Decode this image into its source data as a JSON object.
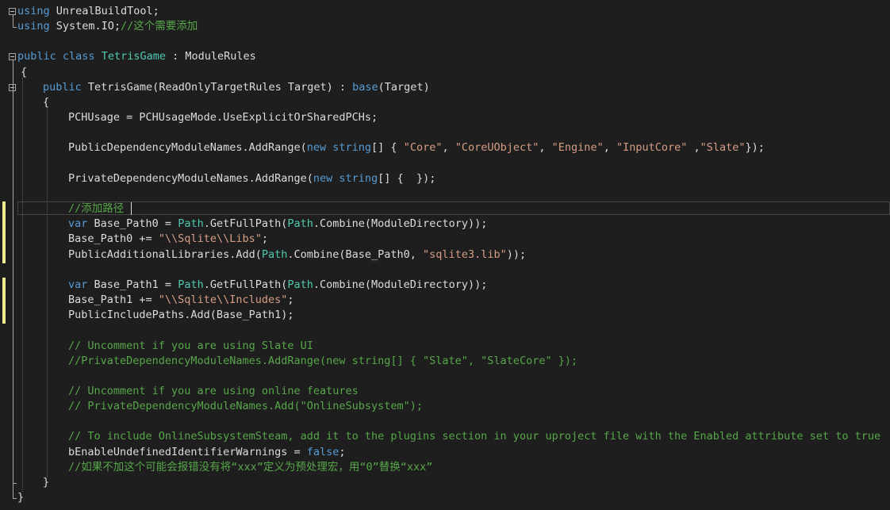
{
  "editor": {
    "language": "csharp",
    "lines": [
      [
        {
          "t": "using",
          "c": "kw"
        },
        {
          "t": " UnrealBuildTool;",
          "c": "id"
        }
      ],
      [
        {
          "t": "using",
          "c": "kw"
        },
        {
          "t": " System.IO;",
          "c": "id"
        },
        {
          "t": "//这个需要添加",
          "c": "cm"
        }
      ],
      [],
      [
        {
          "t": "public",
          "c": "kw"
        },
        {
          "t": " ",
          "c": "id"
        },
        {
          "t": "class",
          "c": "kw"
        },
        {
          "t": " ",
          "c": "id"
        },
        {
          "t": "TetrisGame",
          "c": "ty"
        },
        {
          "t": " : ModuleRules",
          "c": "id"
        }
      ],
      [
        {
          "t": "{",
          "c": "id"
        }
      ],
      [
        {
          "t": "public",
          "c": "kw"
        },
        {
          "t": " TetrisGame(ReadOnlyTargetRules Target) : ",
          "c": "id"
        },
        {
          "t": "base",
          "c": "kw"
        },
        {
          "t": "(Target)",
          "c": "id"
        }
      ],
      [
        {
          "t": "{",
          "c": "id"
        }
      ],
      [
        {
          "t": "PCHUsage = PCHUsageMode.UseExplicitOrSharedPCHs;",
          "c": "id"
        }
      ],
      [],
      [
        {
          "t": "PublicDependencyModuleNames.AddRange(",
          "c": "id"
        },
        {
          "t": "new",
          "c": "kw"
        },
        {
          "t": " ",
          "c": "id"
        },
        {
          "t": "string",
          "c": "kw"
        },
        {
          "t": "[] { ",
          "c": "id"
        },
        {
          "t": "\"Core\"",
          "c": "st"
        },
        {
          "t": ", ",
          "c": "id"
        },
        {
          "t": "\"CoreUObject\"",
          "c": "st"
        },
        {
          "t": ", ",
          "c": "id"
        },
        {
          "t": "\"Engine\"",
          "c": "st"
        },
        {
          "t": ", ",
          "c": "id"
        },
        {
          "t": "\"InputCore\"",
          "c": "st"
        },
        {
          "t": " ,",
          "c": "id"
        },
        {
          "t": "\"Slate\"",
          "c": "st"
        },
        {
          "t": "});",
          "c": "id"
        }
      ],
      [],
      [
        {
          "t": "PrivateDependencyModuleNames.AddRange(",
          "c": "id"
        },
        {
          "t": "new",
          "c": "kw"
        },
        {
          "t": " ",
          "c": "id"
        },
        {
          "t": "string",
          "c": "kw"
        },
        {
          "t": "[] {  });",
          "c": "id"
        }
      ],
      [],
      [
        {
          "t": "//添加路径",
          "c": "cm"
        }
      ],
      [
        {
          "t": "var",
          "c": "kw"
        },
        {
          "t": " Base_Path0 = ",
          "c": "id"
        },
        {
          "t": "Path",
          "c": "ty"
        },
        {
          "t": ".GetFullPath(",
          "c": "id"
        },
        {
          "t": "Path",
          "c": "ty"
        },
        {
          "t": ".Combine(ModuleDirectory));",
          "c": "id"
        }
      ],
      [
        {
          "t": "Base_Path0 += ",
          "c": "id"
        },
        {
          "t": "\"\\\\Sqlite\\\\Libs\"",
          "c": "st"
        },
        {
          "t": ";",
          "c": "id"
        }
      ],
      [
        {
          "t": "PublicAdditionalLibraries.Add(",
          "c": "id"
        },
        {
          "t": "Path",
          "c": "ty"
        },
        {
          "t": ".Combine(Base_Path0, ",
          "c": "id"
        },
        {
          "t": "\"sqlite3.lib\"",
          "c": "st"
        },
        {
          "t": "));",
          "c": "id"
        }
      ],
      [],
      [
        {
          "t": "var",
          "c": "kw"
        },
        {
          "t": " Base_Path1 = ",
          "c": "id"
        },
        {
          "t": "Path",
          "c": "ty"
        },
        {
          "t": ".GetFullPath(",
          "c": "id"
        },
        {
          "t": "Path",
          "c": "ty"
        },
        {
          "t": ".Combine(ModuleDirectory));",
          "c": "id"
        }
      ],
      [
        {
          "t": "Base_Path1 += ",
          "c": "id"
        },
        {
          "t": "\"\\\\Sqlite\\\\Includes\"",
          "c": "st"
        },
        {
          "t": ";",
          "c": "id"
        }
      ],
      [
        {
          "t": "PublicIncludePaths.Add(Base_Path1);",
          "c": "id"
        }
      ],
      [],
      [
        {
          "t": "// Uncomment if you are using Slate UI",
          "c": "cm"
        }
      ],
      [
        {
          "t": "//PrivateDependencyModuleNames.AddRange(new string[] { \"Slate\", \"SlateCore\" });",
          "c": "cm"
        }
      ],
      [],
      [
        {
          "t": "// Uncomment if you are using online features",
          "c": "cm"
        }
      ],
      [
        {
          "t": "// PrivateDependencyModuleNames.Add(\"OnlineSubsystem\");",
          "c": "cm"
        }
      ],
      [],
      [
        {
          "t": "// To include OnlineSubsystemSteam, add it to the plugins section in your uproject file with the Enabled attribute set to true",
          "c": "cm"
        }
      ],
      [
        {
          "t": "bEnableUndefinedIdentifierWarnings = ",
          "c": "id"
        },
        {
          "t": "false",
          "c": "kw"
        },
        {
          "t": ";",
          "c": "id"
        }
      ],
      [
        {
          "t": "//如果不加这个可能会报错没有将“xxx”定义为预处理宏，用“0”替换“xxx”",
          "c": "cm"
        }
      ],
      [
        {
          "t": "}",
          "c": "id"
        }
      ],
      [
        {
          "t": "}",
          "c": "id"
        }
      ]
    ],
    "colors": {
      "background": "#1e1e1e",
      "keyword": "#569cd6",
      "type": "#4ec9b0",
      "string": "#d69d85",
      "comment": "#57a64a",
      "identifier": "#dcdcdc",
      "change_marker": "#efef8e"
    },
    "modified_lines": [
      13,
      14,
      15,
      16,
      18,
      19,
      20
    ],
    "fold_icons": [
      "collapse-icon",
      "collapse-icon",
      "collapse-icon"
    ]
  }
}
